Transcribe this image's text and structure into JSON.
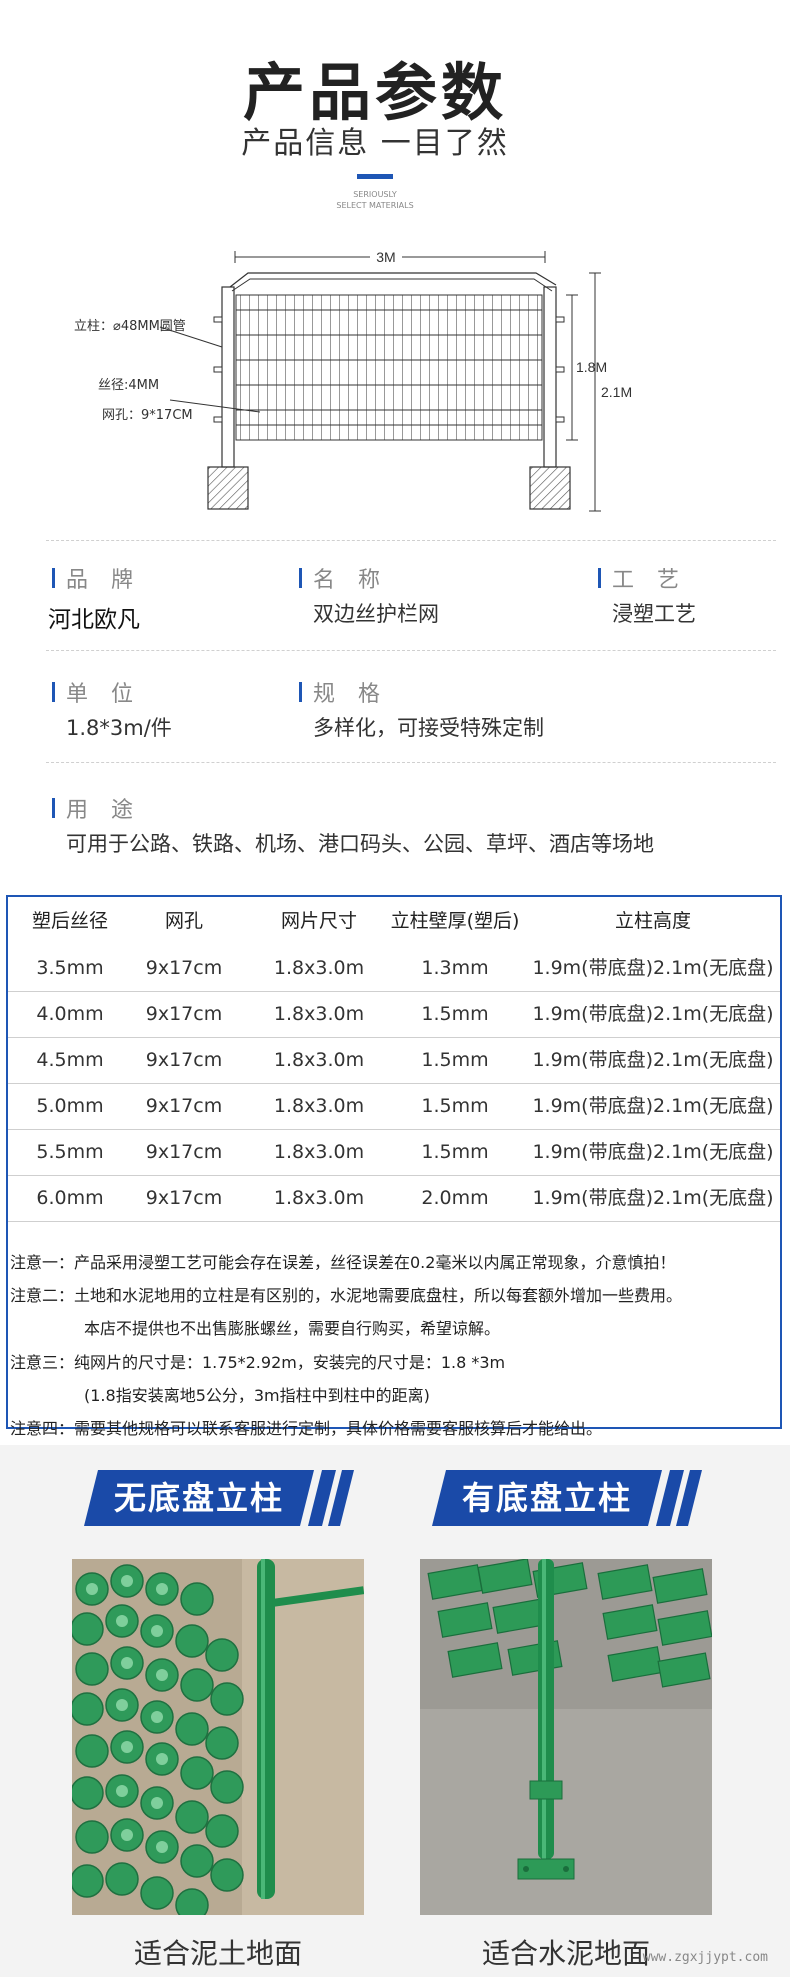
{
  "header": {
    "title": "产品参数",
    "subtitle": "产品信息 一目了然",
    "tagline_1": "SERIOUSLY",
    "tagline_2": "SELECT MATERIALS",
    "accent_color": "#1e56b5"
  },
  "diagram": {
    "width_label": "3M",
    "height_label_1": "1.8M",
    "height_label_2": "2.1M",
    "post_label": "立柱：⌀48MM圆管",
    "wire_label": "丝径:4MM",
    "mesh_label": "网孔：9*17CM"
  },
  "params": {
    "brand_label": "品 牌",
    "brand_value": "河北欧凡",
    "name_label": "名 称",
    "name_value": "双边丝护栏网",
    "craft_label": "工 艺",
    "craft_value": "浸塑工艺",
    "unit_label": "单 位",
    "unit_value": "1.8*3m/件",
    "spec_label": "规 格",
    "spec_value": "多样化，可接受特殊定制",
    "usage_label": "用 途",
    "usage_value": "可用于公路、铁路、机场、港口码头、公园、草坪、酒店等场地"
  },
  "table": {
    "headers": [
      "塑后丝径",
      "网孔",
      "网片尺寸",
      "立柱壁厚(塑后)",
      "立柱高度"
    ],
    "rows": [
      [
        "3.5mm",
        "9x17cm",
        "1.8x3.0m",
        "1.3mm",
        "1.9m(带底盘)2.1m(无底盘)"
      ],
      [
        "4.0mm",
        "9x17cm",
        "1.8x3.0m",
        "1.5mm",
        "1.9m(带底盘)2.1m(无底盘)"
      ],
      [
        "4.5mm",
        "9x17cm",
        "1.8x3.0m",
        "1.5mm",
        "1.9m(带底盘)2.1m(无底盘)"
      ],
      [
        "5.0mm",
        "9x17cm",
        "1.8x3.0m",
        "1.5mm",
        "1.9m(带底盘)2.1m(无底盘)"
      ],
      [
        "5.5mm",
        "9x17cm",
        "1.8x3.0m",
        "1.5mm",
        "1.9m(带底盘)2.1m(无底盘)"
      ],
      [
        "6.0mm",
        "9x17cm",
        "1.8x3.0m",
        "2.0mm",
        "1.9m(带底盘)2.1m(无底盘)"
      ]
    ]
  },
  "notes": [
    "注意一：产品采用浸塑工艺可能会存在误差，丝径误差在0.2毫米以内属正常现象，介意慎拍！",
    "注意二：土地和水泥地用的立柱是有区别的，水泥地需要底盘柱，所以每套额外增加一些费用。",
    "本店不提供也不出售膨胀螺丝，需要自行购买，希望谅解。",
    "注意三：纯网片的尺寸是：1.75*2.92m，安装完的尺寸是：1.8 *3m",
    "(1.8指安装离地5公分，3m指柱中到柱中的距离)",
    "注意四：需要其他规格可以联系客服进行定制，具体价格需要客服核算后才能给出。"
  ],
  "products": [
    {
      "banner": "无底盘立柱",
      "caption": "适合泥土地面"
    },
    {
      "banner": "有底盘立柱",
      "caption": "适合水泥地面"
    }
  ],
  "watermark": "www.zgxjjypt.com"
}
